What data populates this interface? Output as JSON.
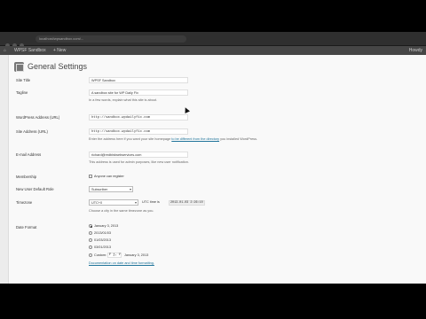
{
  "browser": {
    "url": "localhost/wpsandbox.com/..."
  },
  "adminbar": {
    "site_name": "WPSF Sandbox",
    "new_label": "+ New",
    "howdy": "Howdy"
  },
  "page": {
    "title": "General Settings"
  },
  "fields": {
    "site_title": {
      "label": "Site Title",
      "value": "WPSF Sandbox"
    },
    "tagline": {
      "label": "Tagline",
      "value": "A sandbox site for WP Daily Fix",
      "description": "In a few words, explain what this site is about."
    },
    "wp_address": {
      "label": "WordPress Address (URL)",
      "value": "http://sandbox.wpdailyfix.com"
    },
    "site_address": {
      "label": "Site Address (URL)",
      "value": "http://sandbox.wpdailyfix.com",
      "description_prefix": "Enter the address here if you want your site homepage ",
      "description_link": "to be different from the directory",
      "description_suffix": " you installed WordPress."
    },
    "email": {
      "label": "E-mail Address",
      "value": "richard@redbirdwebservices.com",
      "description": "This address is used for admin purposes, like new user notification."
    },
    "membership": {
      "label": "Membership",
      "checkbox_label": "Anyone can register"
    },
    "default_role": {
      "label": "New User Default Role",
      "value": "Subscriber"
    },
    "timezone": {
      "label": "Timezone",
      "value": "UTC+0",
      "utc_label": "UTC time is",
      "utc_value": "2013-01-03 2:26:10",
      "description": "Choose a city in the same timezone as you."
    },
    "date_format": {
      "label": "Date Format",
      "options": [
        "January 3, 2013",
        "2013/01/03",
        "01/03/2013",
        "03/01/2013"
      ],
      "custom_label": "Custom:",
      "custom_value": "F j, Y",
      "custom_preview": "January 3, 2013",
      "doc_link": "Documentation on date and time formatting."
    }
  }
}
